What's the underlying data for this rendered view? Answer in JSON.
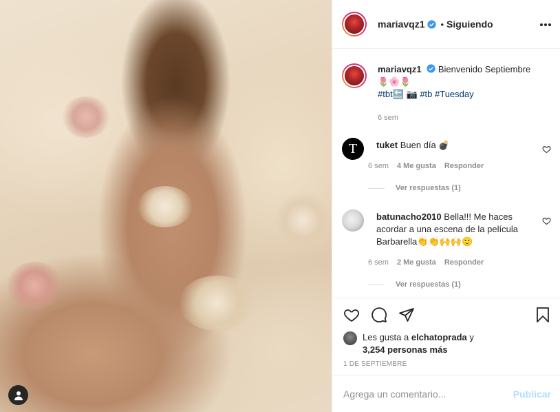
{
  "post": {
    "username": "mariavqz1",
    "separator": "•",
    "follow_status": "Siguiendo"
  },
  "caption": {
    "username": "mariavqz1",
    "text_line1": "Bienvenido Septiembre",
    "emojis": "🌷🌸🌷",
    "hashtags_part1": "#tbt",
    "hashtag_tb": "#tb",
    "hashtag_tuesday": "#Tuesday",
    "emoji_back": "🔙",
    "emoji_camera": "📷",
    "time": "6 sem"
  },
  "comments": [
    {
      "username": "tuket",
      "text": "Buen día 💣",
      "avatar_letter": "T",
      "time": "6 sem",
      "likes": "4 Me gusta",
      "reply": "Responder",
      "view_replies": "Ver respuestas (1)"
    },
    {
      "username": "batunacho2010",
      "text": "Bella!!! Me haces acordar a una escena de la película Barbarella👏👏🙌🙌🙂",
      "time": "6 sem",
      "likes": "2 Me gusta",
      "reply": "Responder",
      "view_replies": "Ver respuestas (1)"
    }
  ],
  "likes": {
    "prefix": "Les gusta a",
    "user": "elchatoprada",
    "connector": "y",
    "others": "3,254 personas más"
  },
  "date": "1 DE SEPTIEMBRE",
  "add_comment": {
    "placeholder": "Agrega un comentario...",
    "publish": "Publicar"
  },
  "colors": {
    "link": "#00376b",
    "verified": "#3897f0",
    "muted": "#8e8e8e",
    "publish_disabled": "#b2dffc"
  },
  "icons": [
    "user-icon",
    "verified-icon",
    "more-icon",
    "heart-icon",
    "comment-icon",
    "share-icon",
    "save-icon"
  ]
}
